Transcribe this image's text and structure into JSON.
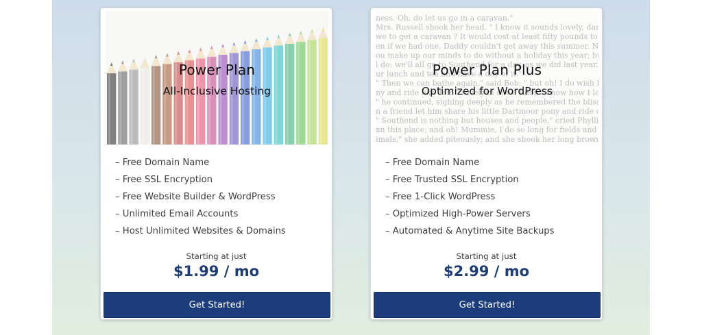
{
  "plans": [
    {
      "title": "Power Plan",
      "subtitle": "All-Inclusive Hosting",
      "image": "colored-pencils-image",
      "features": [
        "– Free Domain Name",
        "– Free SSL Encryption",
        "– Free Website Builder & WordPress",
        "– Unlimited Email Accounts",
        "– Host Unlimited Websites & Domains"
      ],
      "price_caption": "Starting at just",
      "price": "$1.99 / mo",
      "cta": "Get Started!"
    },
    {
      "title": "Power Plan Plus",
      "subtitle": "Optimized for WordPress",
      "image": "book-page-text-image",
      "features": [
        "– Free Domain Name",
        "– Free Trusted SSL Encryption",
        "– Free 1-Click WordPress",
        "– Optimized High-Power Servers",
        "– Automated & Anytime Site Backups"
      ],
      "price_caption": "Starting at just",
      "price": "$2.99 / mo",
      "cta": "Get Started!"
    }
  ],
  "book_text": [
    "ness.   Oh, do let us go in a caravan.\"",
    "Mrs. Russell shook her head. \" I know it sounds lovely, darling; b",
    "we to get a caravan ? It would cost at least fifty pounds to buy o",
    "en if we had one, Daddy couldn't get away this summer.  No, I'",
    "ou make up our minds to do without a holiday this year; but I'll tell yo",
    "l do: we'll all go to Southend for a day, as we did last year, a",
    "ur lunch and tea and have a day of it.\"",
    "\" Then we can bathe again,\" said Bob; \" but oh! I do wish I coul",
    "ny and ride like Tom Trevelyan does.  I don't know how I lo",
    "\" he continued, sighing deeply as he remembered the blissful h",
    "n a friend let him share his little Dartmoor pony and ride occasio",
    "\" Southend is nothing but houses and people,\" cried Phyllis; \" it's n",
    "an this place; and oh! Mummie, I do so long for fields and flow",
    "imals,\" she added piteously; and she shook her long brown hair b"
  ],
  "colors": {
    "accent": "#1c3c7c",
    "price": "#1f3d72",
    "backdrop_top": "#cfdceb",
    "backdrop_bottom": "#e1eedf"
  }
}
